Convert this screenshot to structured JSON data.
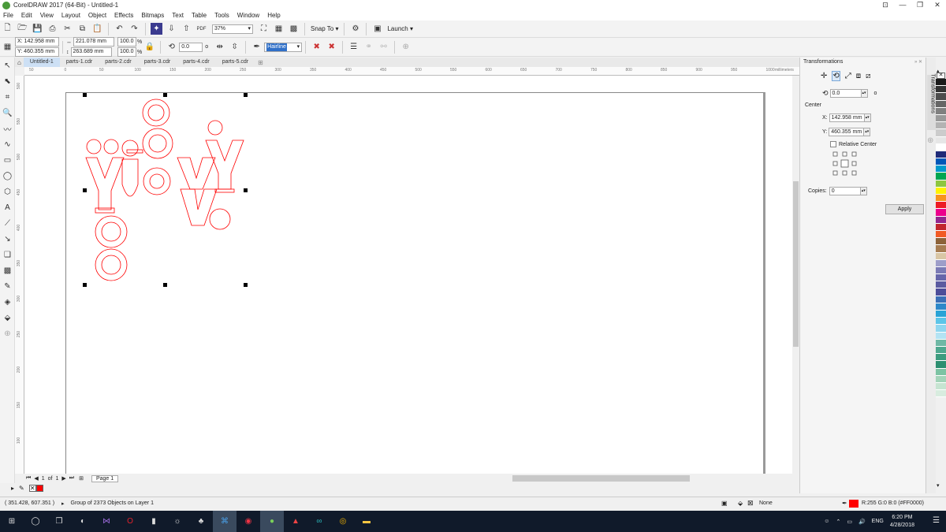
{
  "window": {
    "title": "CorelDRAW 2017 (64-Bit) - Untitled-1",
    "controls": [
      "⊡",
      "—",
      "❐",
      "✕"
    ]
  },
  "menu": [
    "File",
    "Edit",
    "View",
    "Layout",
    "Object",
    "Effects",
    "Bitmaps",
    "Text",
    "Table",
    "Tools",
    "Window",
    "Help"
  ],
  "toolbar1": {
    "zoom": "37%",
    "snap_to": "Snap To",
    "launch": "Launch",
    "pdf": "PDF"
  },
  "toolbar2": {
    "x": "X: 142.958 mm",
    "y": "Y: 460.355 mm",
    "width": "221.078 mm",
    "height": "263.689 mm",
    "scale_x": "100.0",
    "scale_y": "100.0",
    "percent": "%",
    "rotation": "0.0",
    "degree": "o",
    "outline": "Hairline"
  },
  "doc_tabs": [
    "Untitled-1",
    "parts-1.cdr",
    "parts-2.cdr",
    "parts-3.cdr",
    "parts-4.cdr",
    "parts-5.cdr"
  ],
  "ruler": {
    "unit": "millimeters",
    "h_ticks": [
      "50",
      "0",
      "50",
      "100",
      "150",
      "200",
      "250",
      "300",
      "350",
      "400",
      "450",
      "500",
      "550",
      "600",
      "650",
      "700",
      "750",
      "800",
      "850",
      "900",
      "950",
      "1000"
    ],
    "v_ticks": [
      "500",
      "550",
      "500",
      "450",
      "400",
      "350",
      "300",
      "250",
      "200",
      "150",
      "100"
    ]
  },
  "page_nav": {
    "page_of": "1",
    "of_label": "of",
    "total": "1",
    "page_tab": "Page 1"
  },
  "status": {
    "coords": "( 351.428, 607.351 )",
    "message": "Group of 2373 Objects on Layer 1",
    "fill_label": "None",
    "outline_color_label": "R:255 G:0 B:0 (#FF0000)"
  },
  "docker": {
    "title": "Transformations",
    "rotation": "0.0",
    "degree": "o",
    "center_label": "Center",
    "x_label": "X:",
    "x_value": "142.958 mm",
    "y_label": "Y:",
    "y_value": "460.355 mm",
    "relative_center": "Relative Center",
    "copies_label": "Copies:",
    "copies_value": "0",
    "apply": "Apply",
    "side_tab": "Transformations"
  },
  "taskbar": {
    "time": "6:20 PM",
    "date": "4/28/2018",
    "lang": "ENG"
  },
  "colors": {
    "outline_red": "#FF0000",
    "accent_blue": "#cde0f5",
    "taskbar_bg": "#101a2a"
  },
  "palette": [
    "#1a1a1a",
    "#333333",
    "#4d4d4d",
    "#666666",
    "#808080",
    "#999999",
    "#b3b3b3",
    "#cccccc",
    "#e6e6e6",
    "#ffffff",
    "#1f2a78",
    "#0057b8",
    "#0099cc",
    "#00a651",
    "#8dc63f",
    "#fff200",
    "#f7941d",
    "#ed1c24",
    "#ec008c",
    "#92278f",
    "#c1272d",
    "#f15a24",
    "#8c6239",
    "#a67c52",
    "#d9c6a5",
    "#9e9ec9",
    "#7b7bb5",
    "#6666aa",
    "#5b5ba0",
    "#4d4d99",
    "#3b6fb6",
    "#2e88c9",
    "#29a3d6",
    "#5cc5e8",
    "#8fd6ef",
    "#b3e3f3",
    "#6fb8a5",
    "#4fa88f",
    "#3d9c7f",
    "#2c8f70",
    "#7cc3a3",
    "#a3d4b9",
    "#c6e4d1",
    "#d8ecdf"
  ]
}
